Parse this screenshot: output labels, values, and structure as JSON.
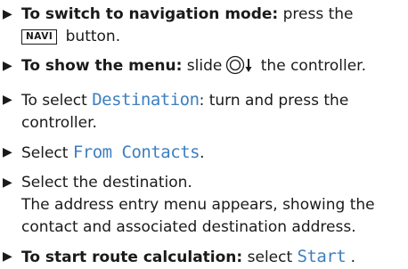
{
  "steps": [
    {
      "lead": "To switch to navigation mode:",
      "text_before_key": " press the",
      "key": "NAVI",
      "text_after_key": " button."
    },
    {
      "lead": "To show the menu:",
      "text_before_icon": " slide",
      "icon": "controller-slide-down-icon",
      "text_after_icon": " the controller."
    },
    {
      "text_before": "To select ",
      "ui_term": "Destination",
      "text_after": ": turn and press the controller."
    },
    {
      "text_before": "Select ",
      "ui_term": "From Contacts",
      "text_after": "."
    },
    {
      "text": "Select the destination.",
      "result": "The address entry menu appears, showing the contact and associated destination address."
    },
    {
      "lead": "To start route calculation:",
      "text_before": " select ",
      "ui_term": "Start",
      "text_after": " ."
    }
  ],
  "bullet_glyph": "▶",
  "colors": {
    "text": "#1a1a1a",
    "ui_term": "#3d7fc0"
  }
}
